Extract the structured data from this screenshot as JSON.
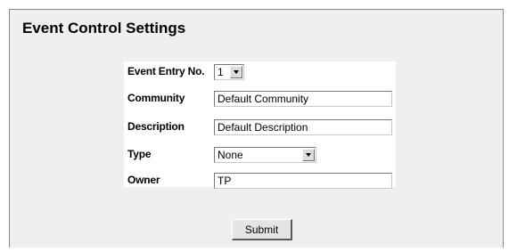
{
  "page": {
    "title": "Event Control Settings"
  },
  "form": {
    "event_entry_no": {
      "label": "Event Entry No.",
      "value": "1",
      "icon": "chevron-down-icon"
    },
    "community": {
      "label": "Community",
      "value": "Default Community"
    },
    "description": {
      "label": "Description",
      "value": "Default Description"
    },
    "type": {
      "label": "Type",
      "value": "None",
      "icon": "chevron-down-icon"
    },
    "owner": {
      "label": "Owner",
      "value": "TP"
    }
  },
  "actions": {
    "submit_label": "Submit"
  },
  "colors": {
    "panel_background": "#efefef",
    "form_background": "#ffffff"
  }
}
